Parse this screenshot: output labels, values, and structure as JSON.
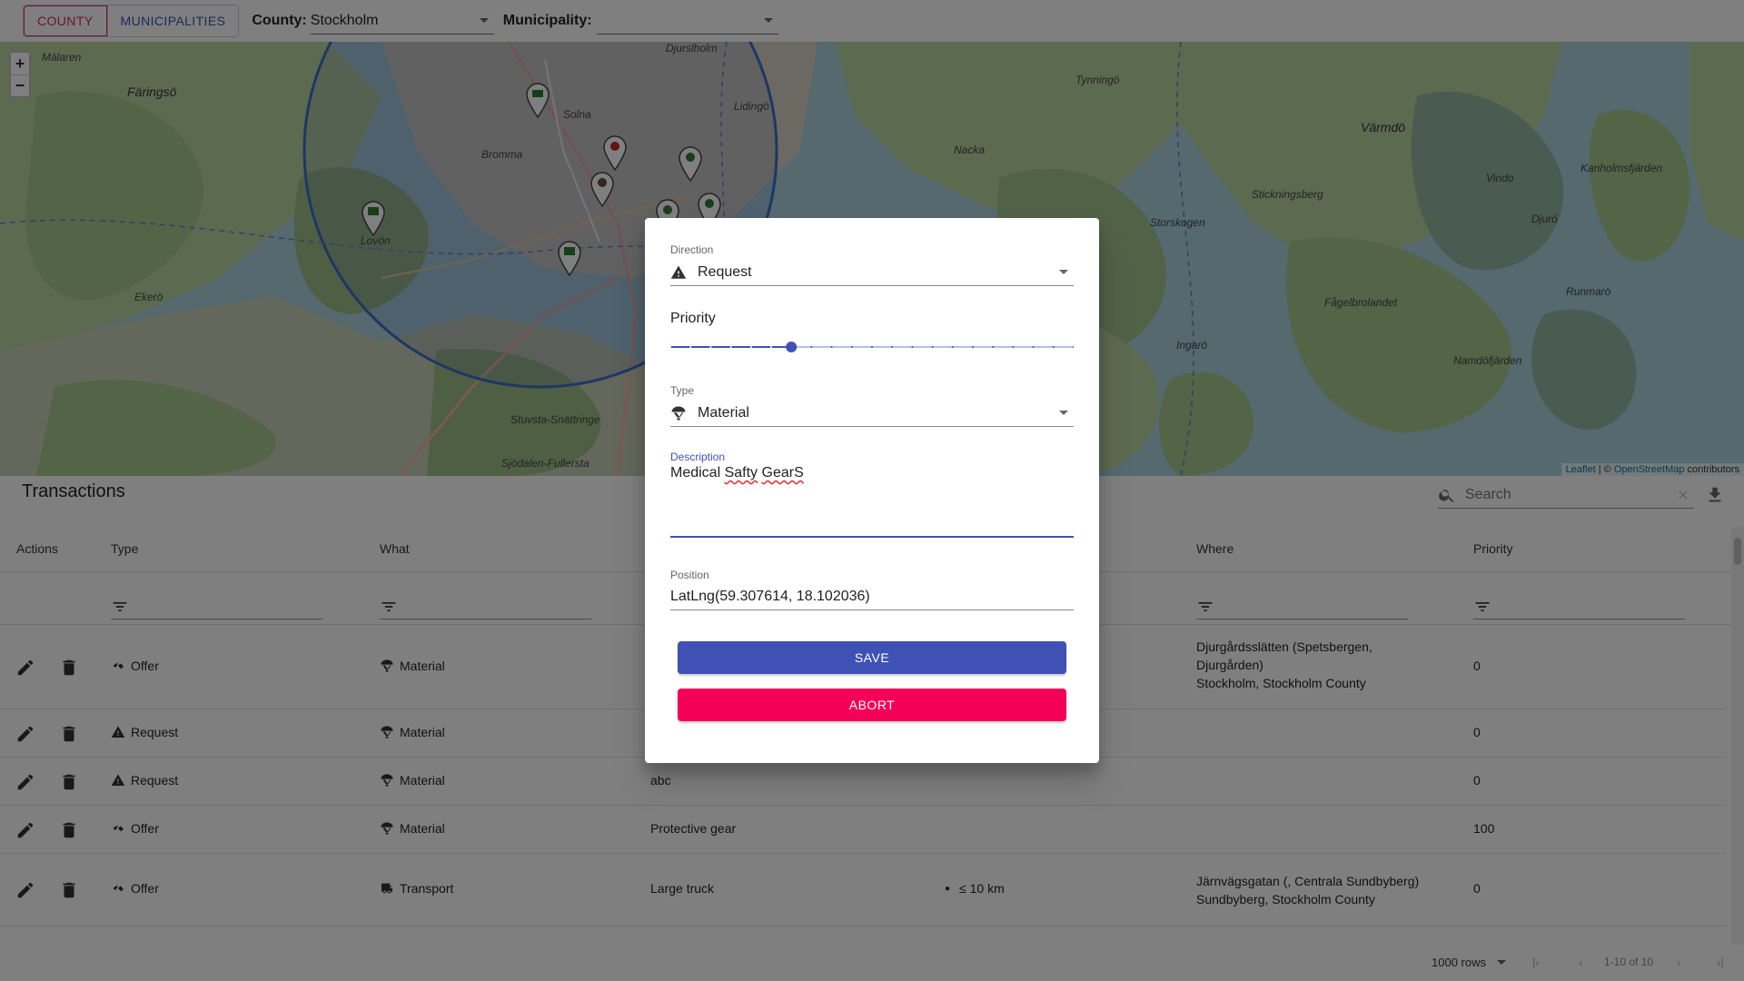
{
  "topbar": {
    "county_button": "COUNTY",
    "municipalities_button": "MUNICIPALITIES",
    "county_label": "County:",
    "county_value": "Stockholm",
    "municipality_label": "Municipality:",
    "municipality_value": ""
  },
  "map": {
    "zoom_in": "+",
    "zoom_out": "−",
    "attribution_leaflet": "Leaflet",
    "attribution_sep": " | © ",
    "attribution_osm": "OpenStreetMap",
    "attribution_suffix": " contributors",
    "places": [
      "Färingsö",
      "Solna",
      "Lidingö",
      "Djurslholm",
      "Värmdö",
      "Vindo",
      "Ekerö",
      "Lovön",
      "Bromma",
      "Stuvsta-Snättringe",
      "Sjödalen-Fullersta",
      "Fågelbrolandet",
      "Ingarö",
      "Runmarö",
      "Tynningö",
      "Nacka",
      "Djurö",
      "Kanholmsfjärden",
      "Mälaren",
      "Namdöfjärden",
      "Stickningsberg",
      "Storskogen"
    ]
  },
  "transactions": {
    "title": "Transactions",
    "search_placeholder": "Search",
    "columns": [
      "Actions",
      "Type",
      "What",
      "Where",
      "Priority"
    ],
    "rows": [
      {
        "type": "Offer",
        "type_icon": "handshake-icon",
        "what": "Material",
        "what_icon": "parachute-icon",
        "description": "",
        "range": "",
        "where_line1": "Djurgårdsslätten (Spetsbergen,",
        "where_line2": "Djurgården)",
        "where_line3": "Stockholm, Stockholm County",
        "priority": "0"
      },
      {
        "type": "Request",
        "type_icon": "warning-icon",
        "what": "Material",
        "what_icon": "parachute-icon",
        "description": "",
        "range": "",
        "where_line1": "",
        "where_line2": "",
        "where_line3": "",
        "priority": "0"
      },
      {
        "type": "Request",
        "type_icon": "warning-icon",
        "what": "Material",
        "what_icon": "parachute-icon",
        "description": "abc",
        "range": "",
        "where_line1": "",
        "where_line2": "",
        "where_line3": "",
        "priority": "0"
      },
      {
        "type": "Offer",
        "type_icon": "handshake-icon",
        "what": "Material",
        "what_icon": "parachute-icon",
        "description": "Protective gear",
        "range": "",
        "where_line1": "",
        "where_line2": "",
        "where_line3": "",
        "priority": "100"
      },
      {
        "type": "Offer",
        "type_icon": "handshake-icon",
        "what": "Transport",
        "what_icon": "truck-icon",
        "description": "Large truck",
        "range": "≤ 10 km",
        "where_line1": "Järnvägsgatan (, Centrala Sundbyberg)",
        "where_line2": "Sundbyberg, Stockholm County",
        "where_line3": "",
        "priority": "0"
      }
    ],
    "pager": {
      "rows_per_page": "1000 rows",
      "range_text": "1-10 of 10"
    }
  },
  "dialog": {
    "direction_label": "Direction",
    "direction_value": "Request",
    "priority_label": "Priority",
    "priority_value": 6,
    "priority_max": 20,
    "type_label": "Type",
    "type_value": "Material",
    "description_label": "Description",
    "description_word1": "Medical",
    "description_word2": "Safty",
    "description_word3": "GearS",
    "position_label": "Position",
    "position_value": "LatLng(59.307614, 18.102036)",
    "save_button": "SAVE",
    "abort_button": "ABORT"
  },
  "colors": {
    "primary": "#3f51b5",
    "secondary": "#f50057",
    "county_accent": "#e0245e"
  }
}
